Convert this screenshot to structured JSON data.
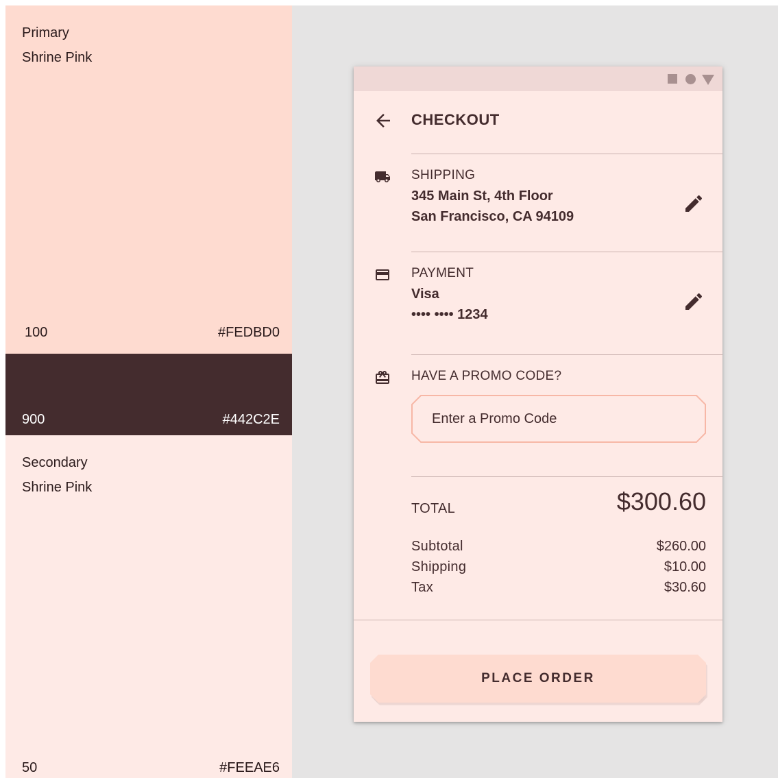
{
  "palette": {
    "primary": {
      "title_line1": "Primary",
      "title_line2": "Shrine Pink",
      "tone": "100",
      "hex": "#FEDBD0",
      "color": "#FEDBD0"
    },
    "dark": {
      "tone": "900",
      "hex": "#442C2E",
      "color": "#442C2E"
    },
    "secondary": {
      "title_line1": "Secondary",
      "title_line2": "Shrine Pink",
      "tone": "50",
      "hex": "#FEEAE6",
      "color": "#FEEAE6"
    }
  },
  "status_bar": {
    "icons": [
      "square-icon",
      "circle-icon",
      "triangle-icon"
    ]
  },
  "header": {
    "back_icon": "arrow-left-icon",
    "title": "CHECKOUT"
  },
  "shipping": {
    "icon": "truck-icon",
    "label": "SHIPPING",
    "line1": "345 Main St, 4th Floor",
    "line2": "San Francisco, CA 94109",
    "edit_icon": "pencil-icon"
  },
  "payment": {
    "icon": "credit-card-icon",
    "label": "PAYMENT",
    "line1": "Visa",
    "line2": "•••• •••• 1234",
    "edit_icon": "pencil-icon"
  },
  "promo": {
    "icon": "gift-card-icon",
    "label": "HAVE A PROMO CODE?",
    "value": "",
    "placeholder": "Enter a Promo Code"
  },
  "totals": {
    "total_label": "TOTAL",
    "total_value": "$300.60",
    "rows": [
      {
        "label": "Subtotal",
        "value": "$260.00"
      },
      {
        "label": "Shipping",
        "value": "$10.00"
      },
      {
        "label": "Tax",
        "value": "$30.60"
      }
    ]
  },
  "actions": {
    "place_order_label": "PLACE ORDER"
  },
  "colors": {
    "primary": "#FEDBD0",
    "on_primary": "#442C2E",
    "surface": "#FEEAE6",
    "outline": "#F7B7A6"
  }
}
